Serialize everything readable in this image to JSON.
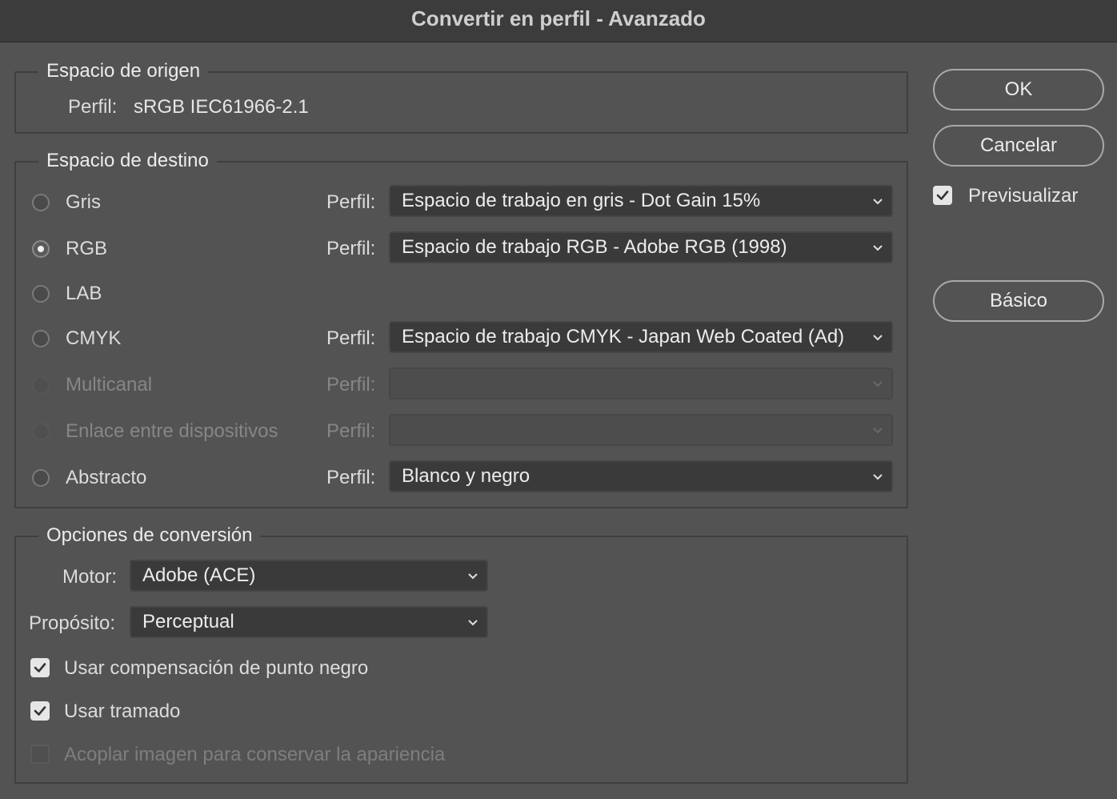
{
  "window": {
    "title": "Convertir en perfil - Avanzado"
  },
  "source": {
    "legend": "Espacio de origen",
    "profile_label": "Perfil:",
    "profile_value": "sRGB IEC61966-2.1"
  },
  "destination": {
    "legend": "Espacio de destino",
    "profile_label": "Perfil:",
    "options": [
      {
        "label": "Gris",
        "selected": false,
        "enabled": true,
        "profile": "Espacio de trabajo en gris - Dot Gain 15%"
      },
      {
        "label": "RGB",
        "selected": true,
        "enabled": true,
        "profile": "Espacio de trabajo RGB - Adobe RGB (1998)"
      },
      {
        "label": "LAB",
        "selected": false,
        "enabled": true
      },
      {
        "label": "CMYK",
        "selected": false,
        "enabled": true,
        "profile": "Espacio de trabajo CMYK - Japan Web Coated (Ad)"
      },
      {
        "label": "Multicanal",
        "selected": false,
        "enabled": false,
        "profile": ""
      },
      {
        "label": "Enlace entre dispositivos",
        "selected": false,
        "enabled": false,
        "profile": ""
      },
      {
        "label": "Abstracto",
        "selected": false,
        "enabled": true,
        "profile": "Blanco y negro"
      }
    ]
  },
  "conversion": {
    "legend": "Opciones de conversión",
    "engine_label": "Motor:",
    "engine_value": "Adobe (ACE)",
    "intent_label": "Propósito:",
    "intent_value": "Perceptual",
    "black_point_label": "Usar compensación de punto negro",
    "black_point_checked": true,
    "dither_label": "Usar tramado",
    "dither_checked": true,
    "flatten_label": "Acoplar imagen para conservar la apariencia",
    "flatten_checked": false,
    "flatten_enabled": false
  },
  "buttons": {
    "ok": "OK",
    "cancel": "Cancelar",
    "preview_label": "Previsualizar",
    "preview_checked": true,
    "basic": "Básico"
  },
  "colors": {
    "background": "#535353",
    "titlebar": "#3c3c3c",
    "select_bg": "#3a3a3a",
    "text": "#ececec",
    "disabled_text": "#868686"
  }
}
